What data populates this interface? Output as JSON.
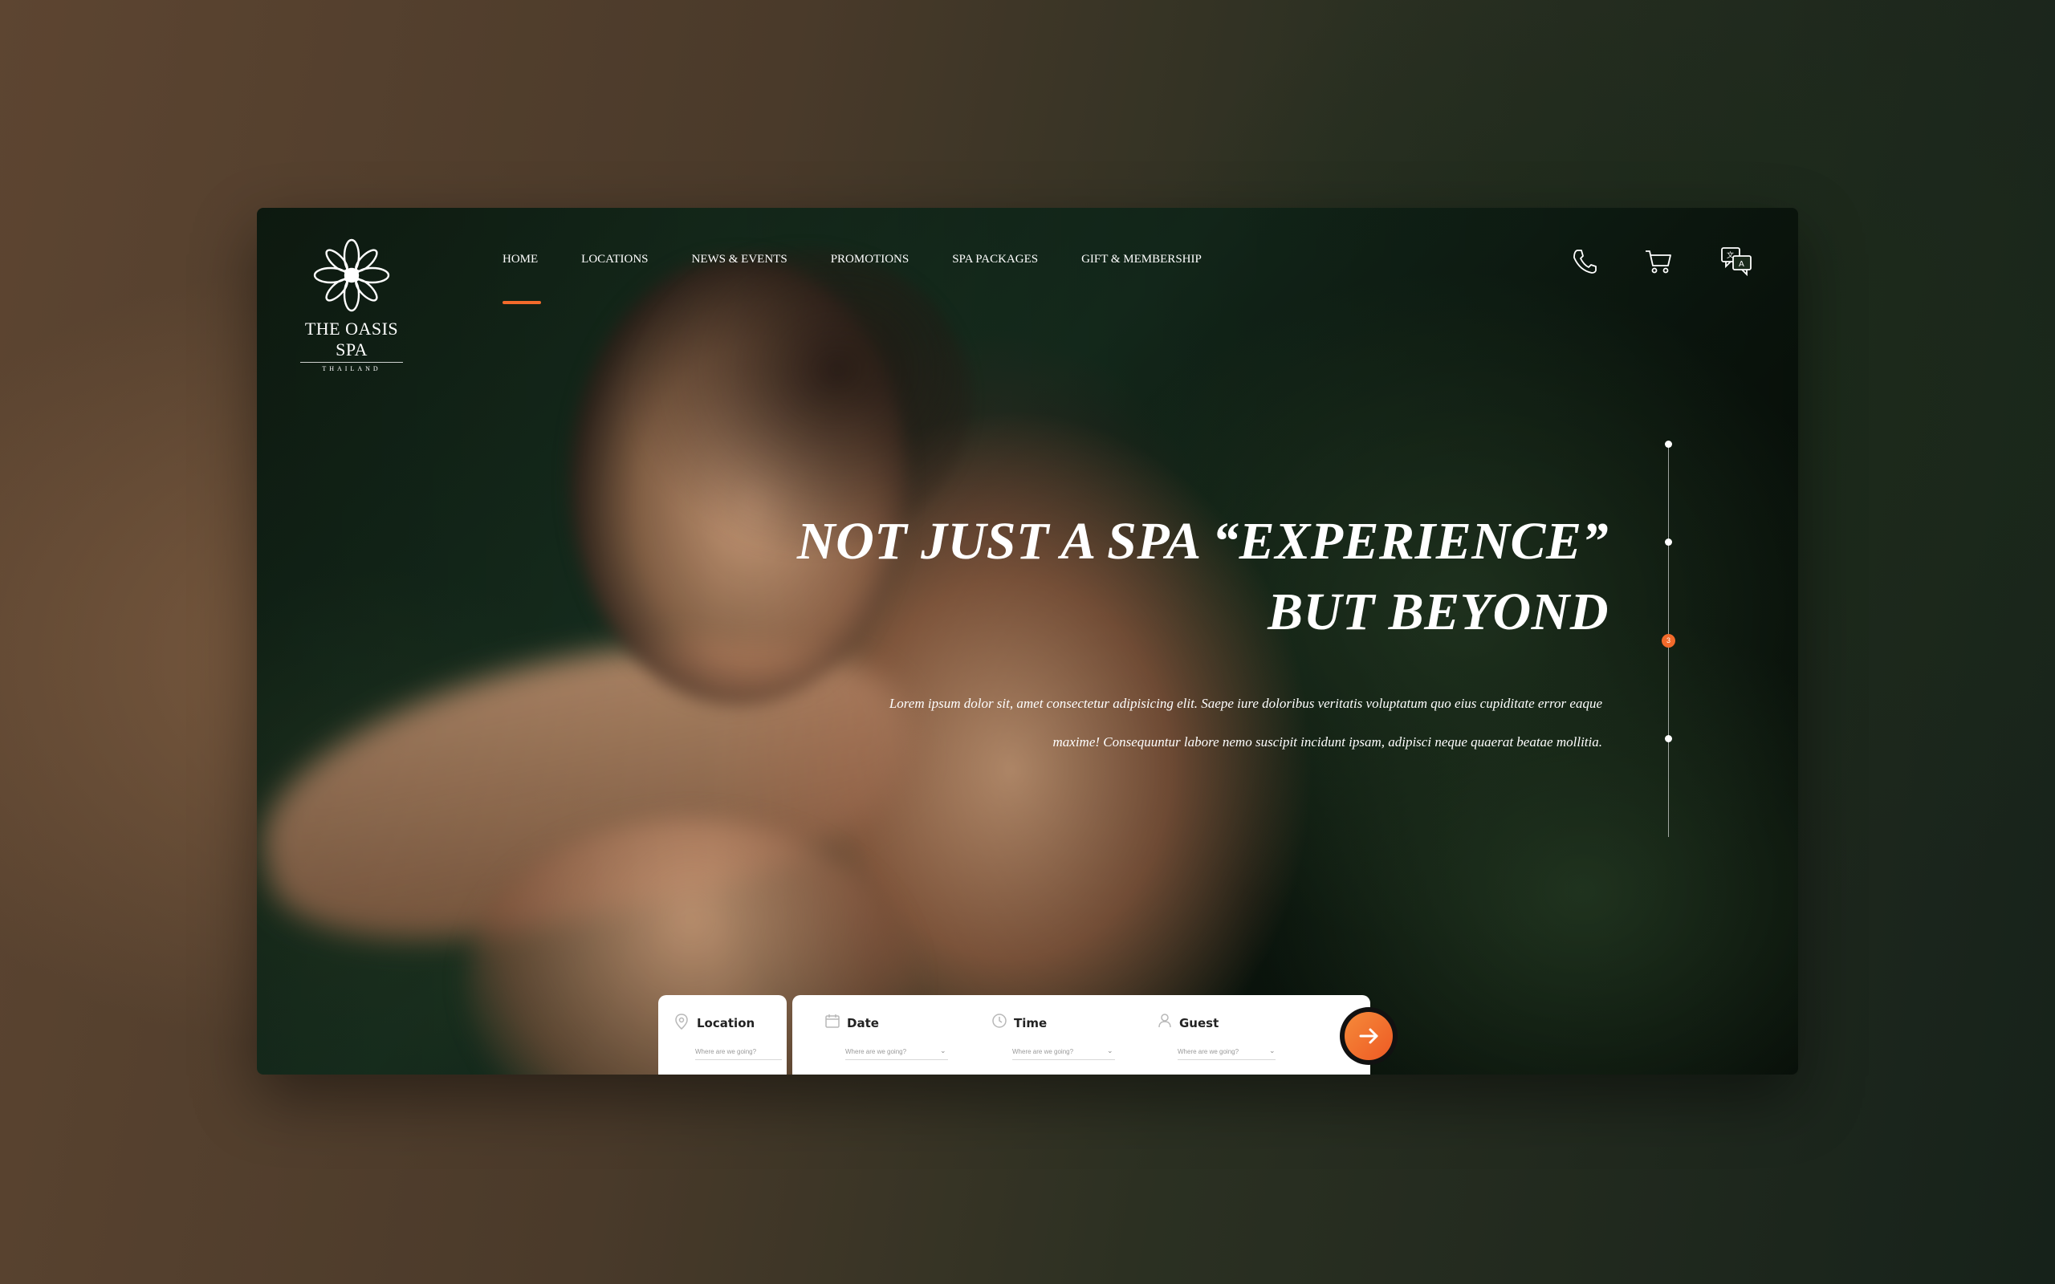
{
  "brand": {
    "name": "THE OASIS SPA",
    "subtitle": "THAILAND",
    "logo_icon": "lotus-mandala-icon"
  },
  "nav": {
    "items": [
      {
        "label": "HOME",
        "active": true
      },
      {
        "label": "LOCATIONS",
        "active": false
      },
      {
        "label": "NEWS & EVENTS",
        "active": false
      },
      {
        "label": "PROMOTIONS",
        "active": false
      },
      {
        "label": "SPA PACKAGES",
        "active": false
      },
      {
        "label": "GIFT & MEMBERSHIP",
        "active": false
      }
    ],
    "icons": [
      "phone-icon",
      "cart-icon",
      "translate-icon"
    ]
  },
  "hero": {
    "title": "NOT JUST A SPA “EXPERIENCE”\nBUT BEYOND",
    "body": "Lorem ipsum dolor sit, amet consectetur adipisicing elit. Saepe iure doloribus veritatis voluptatum quo eius cupiditate error eaque maxime! Consequuntur labore nemo suscipit incidunt ipsam, adipisci neque quaerat beatae mollitia."
  },
  "slider": {
    "count": 4,
    "active_index": 2,
    "active_label": "3"
  },
  "booking": {
    "fields": [
      {
        "label": "Location",
        "placeholder": "Where are we going?",
        "icon": "location-pin-icon"
      },
      {
        "label": "Date",
        "placeholder": "Where are we going?",
        "icon": "calendar-icon"
      },
      {
        "label": "Time",
        "placeholder": "Where are we going?",
        "icon": "clock-icon"
      },
      {
        "label": "Guest",
        "placeholder": "Where are we going?",
        "icon": "user-icon"
      }
    ],
    "submit_icon": "arrow-right-icon"
  },
  "colors": {
    "accent": "#f26a2b",
    "text_light": "#ffffff",
    "panel": "#ffffff"
  }
}
